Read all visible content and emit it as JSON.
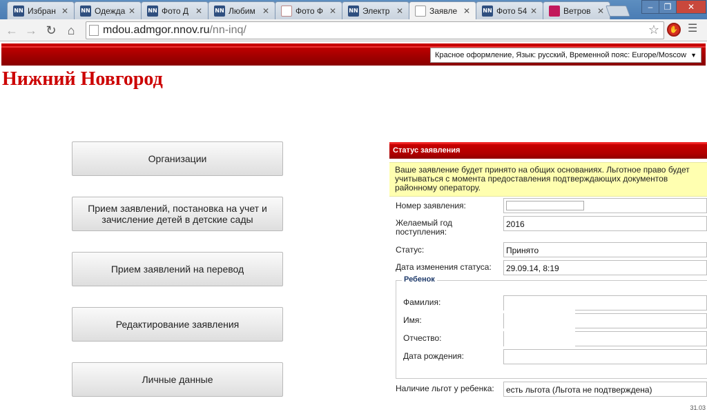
{
  "browser": {
    "tabs": [
      {
        "icon": "NN",
        "label": "Избран",
        "kind": "nn"
      },
      {
        "icon": "NN",
        "label": "Одежда",
        "kind": "nn"
      },
      {
        "icon": "NN",
        "label": "Фото Д",
        "kind": "nn"
      },
      {
        "icon": "NN",
        "label": "Любим",
        "kind": "nn"
      },
      {
        "icon": "",
        "label": "Фото Ф",
        "kind": "photo"
      },
      {
        "icon": "NN",
        "label": "Электр",
        "kind": "nn"
      },
      {
        "icon": "",
        "label": "Заявле",
        "kind": "doc"
      },
      {
        "icon": "NN",
        "label": "Фото 54",
        "kind": "nn"
      },
      {
        "icon": "",
        "label": "Ветров",
        "kind": "pink"
      }
    ],
    "url_host": "mdou.admgor.nnov.ru",
    "url_path": "/nn-inq/"
  },
  "header": {
    "settings_dropdown": "Красное оформление, Язык: русский, Временной пояс: Europe/Moscow",
    "city": "Нижний Новгород"
  },
  "menu": [
    "Организации",
    "Прием заявлений, постановка на учет и зачисление детей в детские сады",
    "Прием заявлений на перевод",
    "Редактирование заявления",
    "Личные данные"
  ],
  "status": {
    "title": "Статус заявления",
    "notice": "Ваше заявление будет принято на общих основаниях. Льготное право будет учитываться с момента предоставления подтверждающих документов районному оператору.",
    "fields": {
      "number_label": "Номер заявления:",
      "number_value": "",
      "year_label": "Желаемый год поступления:",
      "year_value": "2016",
      "status_label": "Статус:",
      "status_value": "Принято",
      "date_label": "Дата изменения статуса:",
      "date_value": "29.09.14, 8:19"
    },
    "child": {
      "legend": "Ребенок",
      "surname_label": "Фамилия:",
      "name_label": "Имя:",
      "patronymic_label": "Отчество:",
      "birthdate_label": "Дата рождения:"
    },
    "benefit_label": "Наличие льгот у ребенка:",
    "benefit_value": "есть льгота (Льгота не подтверждена)"
  },
  "footer": {
    "version": "31.03"
  }
}
